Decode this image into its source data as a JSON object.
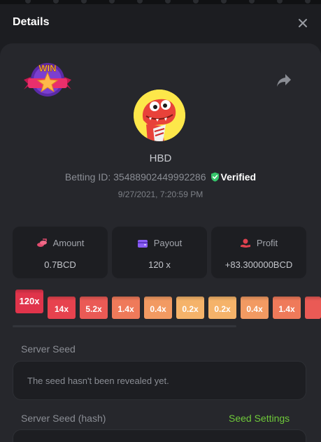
{
  "header": {
    "title": "Details"
  },
  "bet": {
    "username": "HBD",
    "betting_id_label": "Betting ID: 3548890244999228​6",
    "betting_id_value": "35488902449992286",
    "verified_label": "Verified",
    "timestamp": "9/27/2021, 7:20:59 PM"
  },
  "stats": [
    {
      "label": "Amount",
      "value": "0.7BCD",
      "icon": "coins-icon",
      "color": "#e14b6e"
    },
    {
      "label": "Payout",
      "value": "120 x",
      "icon": "wallet-icon",
      "color": "#8a5cf6"
    },
    {
      "label": "Profit",
      "value": "+83.300000BCD",
      "icon": "hand-coin-icon",
      "color": "#e0424f"
    }
  ],
  "multipliers": [
    {
      "label": "120x",
      "color": "#e0344b"
    },
    {
      "label": "14x",
      "color": "#e7424e"
    },
    {
      "label": "5.2x",
      "color": "#ea5a55"
    },
    {
      "label": "1.4x",
      "color": "#ef7a5a"
    },
    {
      "label": "0.4x",
      "color": "#f29a62"
    },
    {
      "label": "0.2x",
      "color": "#f5b36a"
    },
    {
      "label": "0.2x",
      "color": "#f5b36a"
    },
    {
      "label": "0.4x",
      "color": "#f29a62"
    },
    {
      "label": "1.4x",
      "color": "#ef7a5a"
    },
    {
      "label": "",
      "color": "#ea5a55"
    }
  ],
  "server_seed": {
    "label": "Server Seed",
    "value": "The seed hasn't been revealed yet."
  },
  "server_seed_hash": {
    "label": "Server Seed (hash)",
    "link": "Seed Settings"
  },
  "badge": {
    "text": "WIN"
  },
  "colors": {
    "accent_green": "#6fc93a",
    "verified_green": "#35c46a",
    "panel": "#26272c",
    "card": "#1d1e22"
  }
}
